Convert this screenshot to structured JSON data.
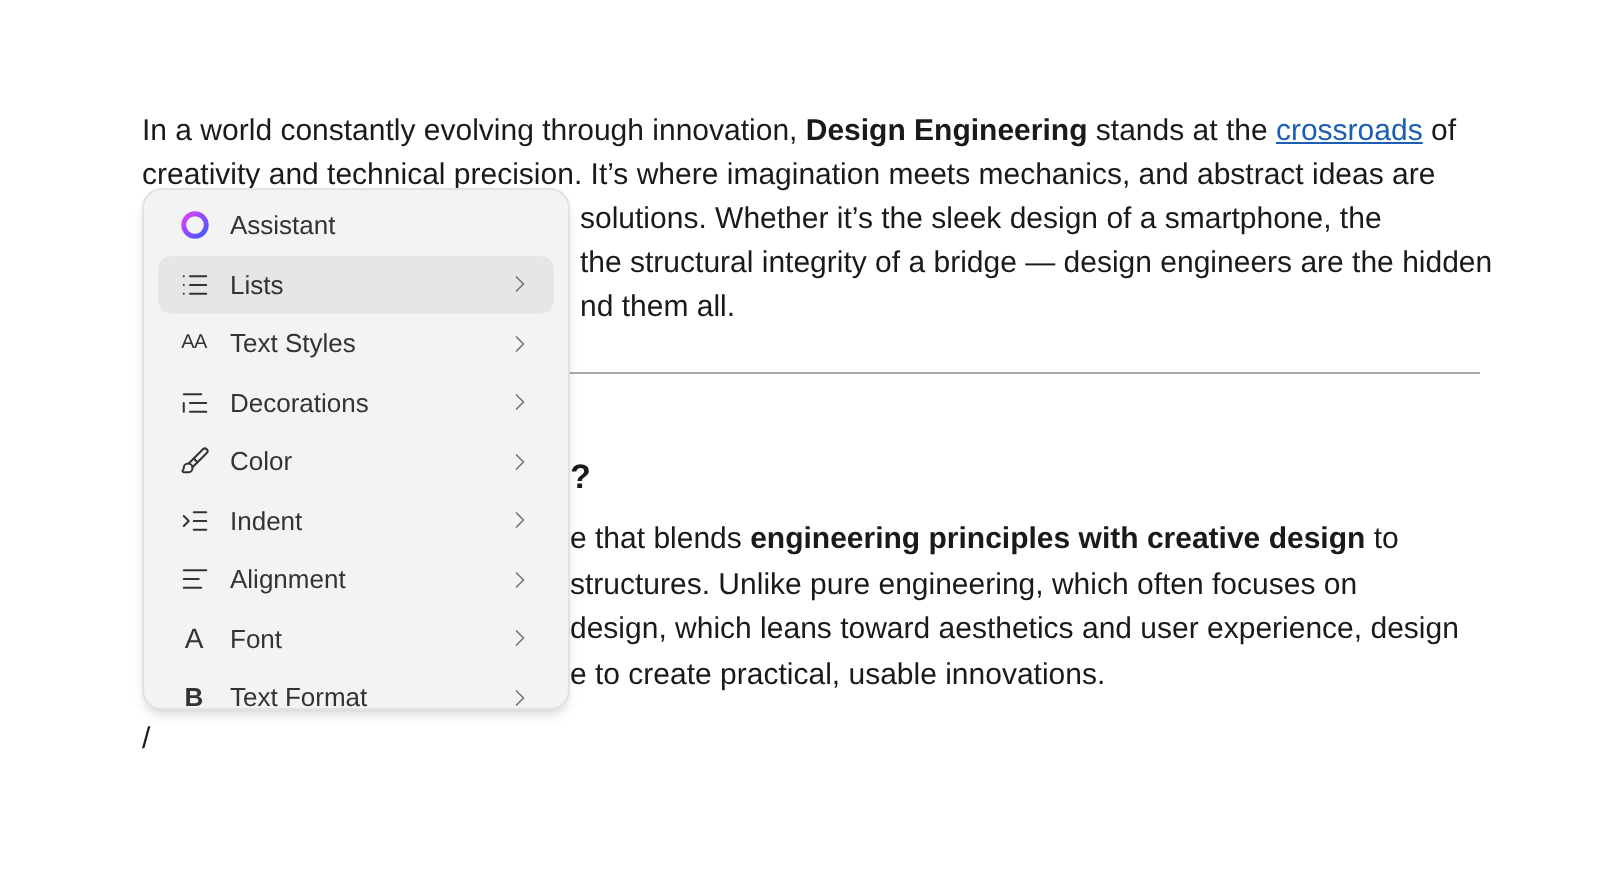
{
  "intro": {
    "line_1": {
      "text": "In a world constantly evolving through innovation, **Design Engineering** stands at the ",
      "link": "crossroads",
      "after": " of"
    },
    "line_2": "creativity and technical precision. It’s where imagination meets mechanics, and abstract ideas are",
    "fragments": [
      "solutions. Whether it’s the sleek design of a smartphone, the",
      "the structural integrity of a bridge — design engineers are the hidden",
      "nd them all."
    ]
  },
  "heading_fragment": "?",
  "body_fragments": [
    "e that blends **engineering principles with creative design** to",
    "structures. Unlike pure engineering, which often focuses on",
    "design, which leans toward aesthetics and user experience, design",
    "e to create practical, usable innovations."
  ],
  "cursor_line": "/",
  "menu": {
    "items": [
      {
        "label": "Assistant",
        "selected": false,
        "submenu": false
      },
      {
        "label": "Lists",
        "selected": true,
        "submenu": true
      },
      {
        "label": "Text Styles",
        "glyph": "AA",
        "selected": false,
        "submenu": true
      },
      {
        "label": "Decorations",
        "selected": false,
        "submenu": true
      },
      {
        "label": "Color",
        "selected": false,
        "submenu": true
      },
      {
        "label": "Indent",
        "selected": false,
        "submenu": true
      },
      {
        "label": "Alignment",
        "selected": false,
        "submenu": true
      },
      {
        "label": "Font",
        "glyph": "A",
        "selected": false,
        "submenu": true
      },
      {
        "label": "Text Format",
        "glyph": "B",
        "selected": false,
        "submenu": true
      }
    ]
  }
}
